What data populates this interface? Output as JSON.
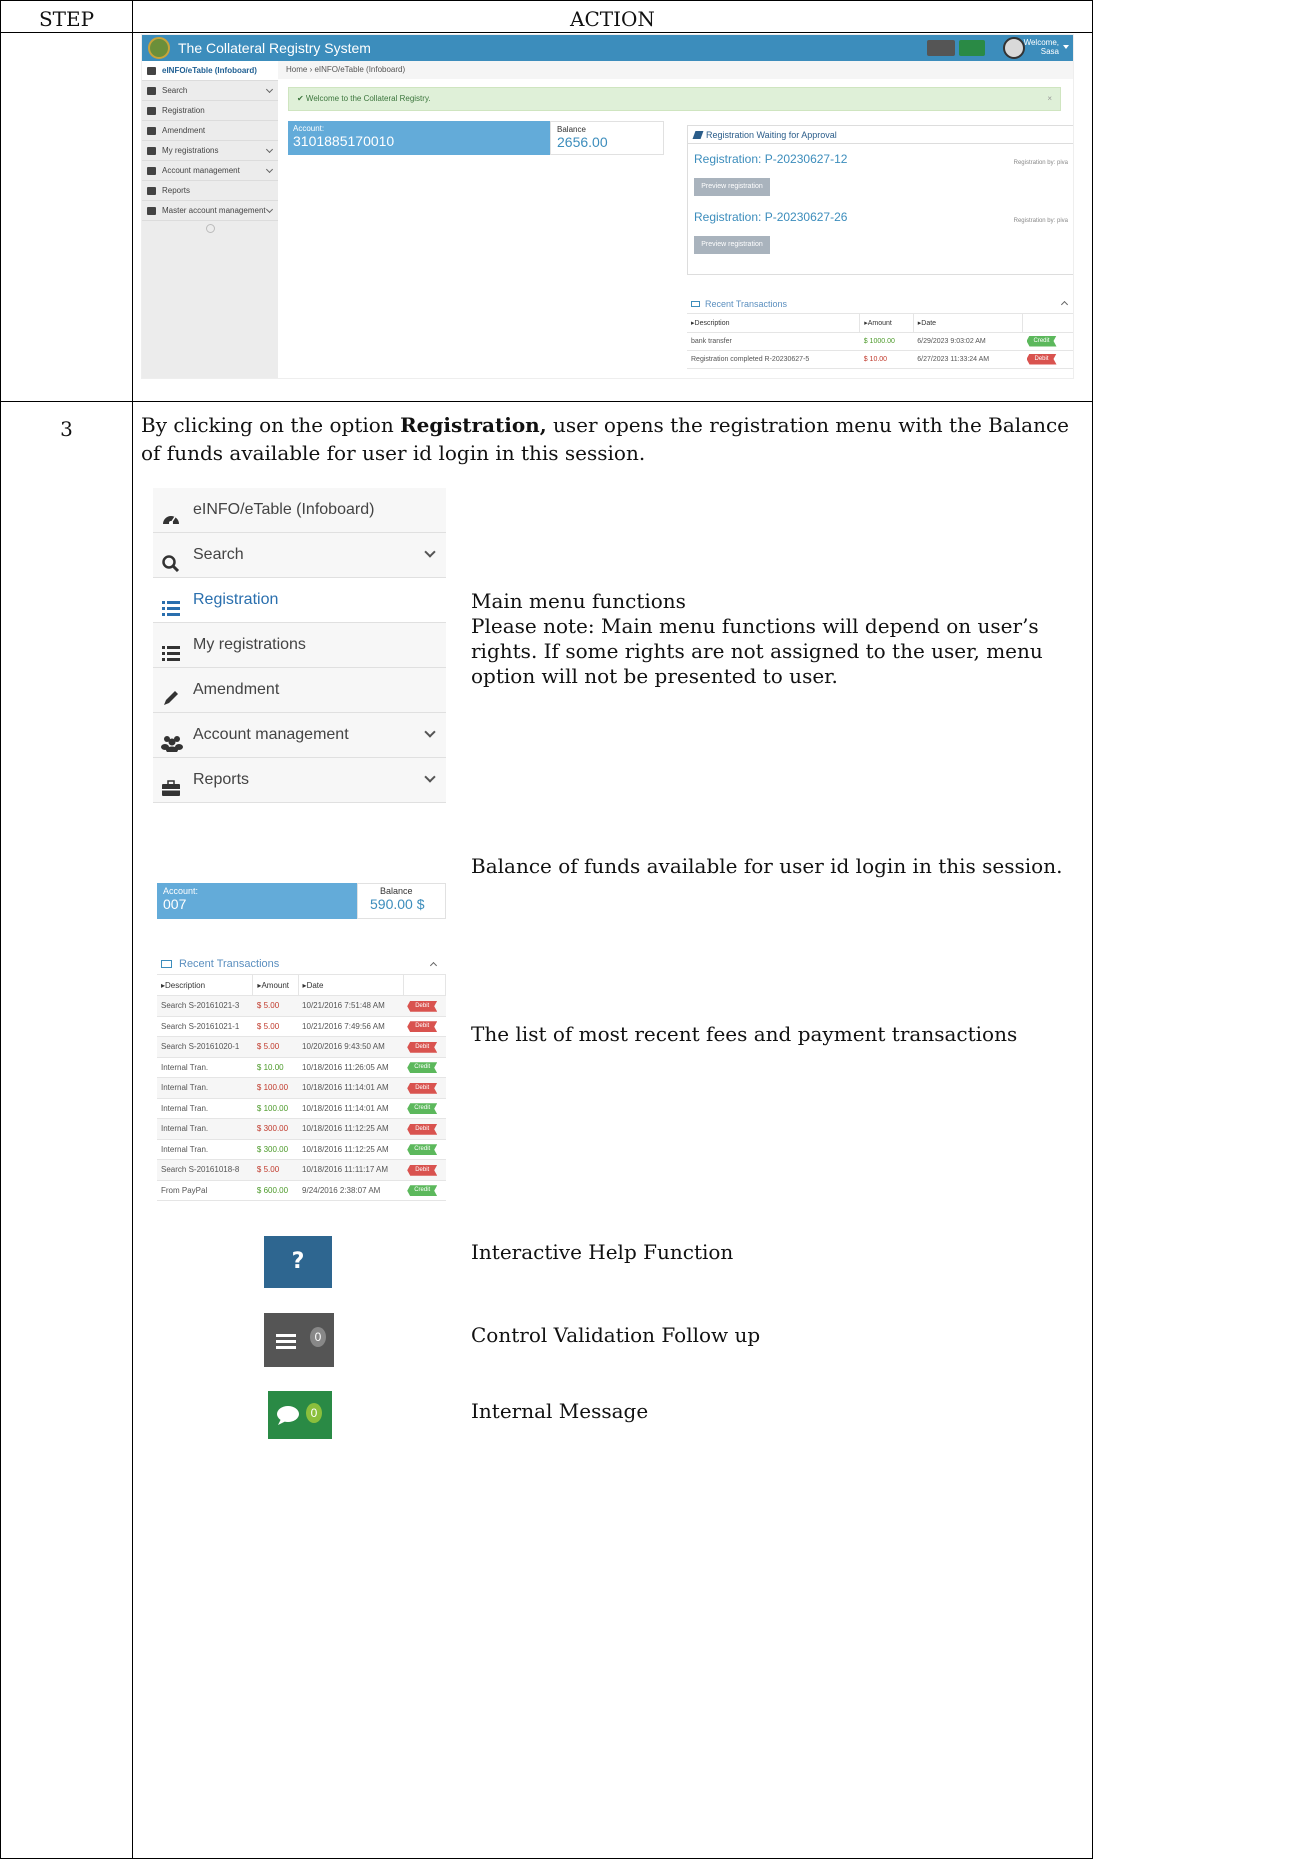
{
  "table": {
    "header_step": "STEP",
    "header_action": "ACTION",
    "step_number": "3"
  },
  "screenshot": {
    "app_title": "The Collateral Registry System",
    "welcome_line1": "Welcome,",
    "welcome_line2": "Sasa",
    "sidebar": [
      {
        "label": "eINFO/eTable (Infoboard)",
        "active": true
      },
      {
        "label": "Search",
        "chevron": true
      },
      {
        "label": "Registration"
      },
      {
        "label": "Amendment"
      },
      {
        "label": "My registrations",
        "chevron": true
      },
      {
        "label": "Account management",
        "chevron": true
      },
      {
        "label": "Reports"
      },
      {
        "label": "Master account management",
        "chevron": true
      }
    ],
    "breadcrumb": "Home  ›  eINFO/eTable (Infoboard)",
    "alert": "✔ Welcome to the Collateral Registry.",
    "account_label": "Account:",
    "account_number": "3101885170010",
    "balance_label": "Balance",
    "balance_value": "2656.00",
    "waiting": {
      "title": "Registration Waiting for Approval",
      "items": [
        {
          "registration": "Registration:  P-20230627-12",
          "by": "Registration by: piva",
          "button": "Preview registration"
        },
        {
          "registration": "Registration:  P-20230627-26",
          "by": "Registration by: piva",
          "button": "Preview registration"
        }
      ]
    },
    "transactions": {
      "title": "Recent Transactions",
      "columns": [
        "▸Description",
        "▸Amount",
        "▸Date"
      ],
      "rows": [
        {
          "description": "bank transfer",
          "amount": "$ 1000.00",
          "date": "6/29/2023 9:03:02 AM",
          "type": "Credit"
        },
        {
          "description": "Registration completed R-20230627-5",
          "amount": "$ 10.00",
          "date": "6/27/2023 11:33:24 AM",
          "type": "Debit"
        }
      ]
    }
  },
  "step3": {
    "intro_bold": "Registration,",
    "intro_before": "By clicking on the option ",
    "intro_after": " user opens the registration menu with the Balance of funds available for user id login in this session.",
    "menu": [
      {
        "label": "eINFO/eTable (Infoboard)",
        "icon": "dashboard-icon"
      },
      {
        "label": "Search",
        "icon": "search-icon",
        "chevron": true
      },
      {
        "label": "Registration",
        "icon": "list-icon",
        "active": true
      },
      {
        "label": "My registrations",
        "icon": "list-icon"
      },
      {
        "label": "Amendment",
        "icon": "pencil-icon"
      },
      {
        "label": "Account management",
        "icon": "users-icon",
        "chevron": true
      },
      {
        "label": "Reports",
        "icon": "briefcase-icon",
        "chevron": true
      }
    ],
    "menu_title": "Main menu functions",
    "menu_note": "Please note: Main menu functions will depend on user’s rights. If some rights are not assigned to the user, menu option will not be presented to user.",
    "account_label": "Account:",
    "account_number": "007",
    "balance_label": "Balance",
    "balance_value": "590.00 $",
    "balance_desc": "Balance of funds available for user id login in this session.",
    "transactions": {
      "title": "Recent Transactions",
      "columns": [
        "▸Description",
        "▸Amount",
        "▸Date"
      ],
      "rows": [
        {
          "description": "Search S-20161021-3",
          "amount": "$ 5.00",
          "date": "10/21/2016 7:51:48 AM",
          "type": "Debit"
        },
        {
          "description": "Search S-20161021-1",
          "amount": "$ 5.00",
          "date": "10/21/2016 7:49:56 AM",
          "type": "Debit"
        },
        {
          "description": "Search S-20161020-1",
          "amount": "$ 5.00",
          "date": "10/20/2016 9:43:50 AM",
          "type": "Debit"
        },
        {
          "description": "Internal Tran.",
          "amount": "$ 10.00",
          "date": "10/18/2016 11:26:05 AM",
          "type": "Credit"
        },
        {
          "description": "Internal Tran.",
          "amount": "$ 100.00",
          "date": "10/18/2016 11:14:01 AM",
          "type": "Debit"
        },
        {
          "description": "Internal Tran.",
          "amount": "$ 100.00",
          "date": "10/18/2016 11:14:01 AM",
          "type": "Credit"
        },
        {
          "description": "Internal Tran.",
          "amount": "$ 300.00",
          "date": "10/18/2016 11:12:25 AM",
          "type": "Debit"
        },
        {
          "description": "Internal Tran.",
          "amount": "$ 300.00",
          "date": "10/18/2016 11:12:25 AM",
          "type": "Credit"
        },
        {
          "description": "Search S-20161018-8",
          "amount": "$ 5.00",
          "date": "10/18/2016 11:11:17 AM",
          "type": "Debit"
        },
        {
          "description": "From PayPal",
          "amount": "$ 600.00",
          "date": "9/24/2016 2:38:07 AM",
          "type": "Credit"
        }
      ]
    },
    "transactions_desc": "The list of most recent fees and payment transactions",
    "help_symbol": "?",
    "help_label": "Interactive Help Function",
    "control_count": "0",
    "control_label": "Control Validation Follow up",
    "message_count": "0",
    "message_label": "Internal Message"
  },
  "colors": {
    "brand_blue": "#3c8dbc",
    "account_blue": "#63abd9",
    "credit_green": "#5cb85c",
    "debit_red": "#d9534f"
  }
}
